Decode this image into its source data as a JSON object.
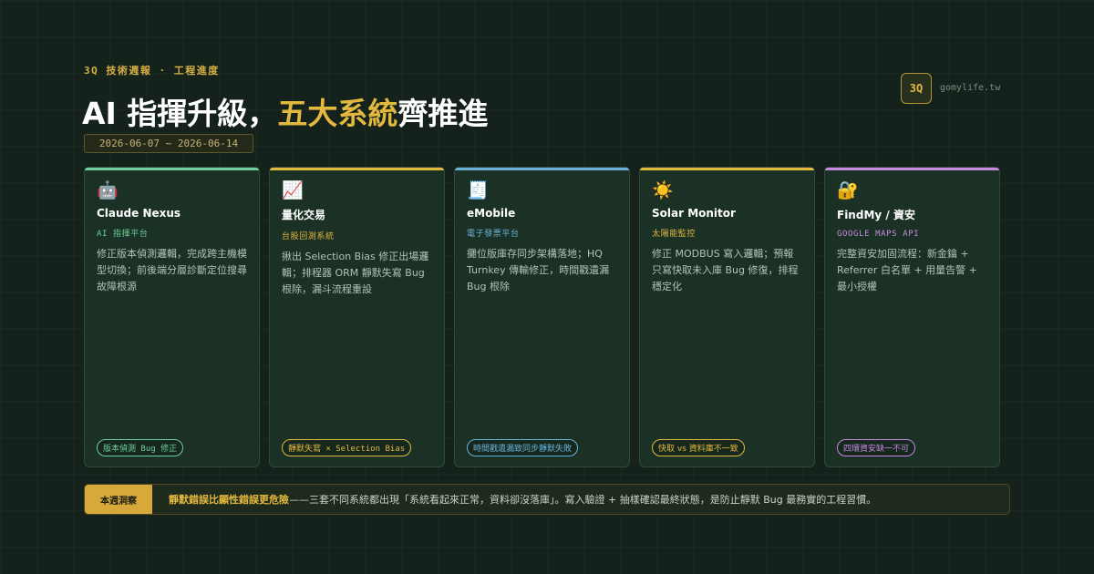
{
  "header": {
    "kicker": "3Q 技術週報 · 工程進度",
    "title_prefix": "AI 指揮升級，",
    "title_highlight": "五大系統",
    "title_suffix": "齊推進",
    "date_range": "2026-06-07 ~ 2026-06-14",
    "brand_badge": "3Q",
    "brand_domain": "gomylife.tw"
  },
  "cards": [
    {
      "icon": "🤖",
      "icon_name": "robot-icon",
      "name": "Claude Nexus",
      "subtitle": "AI 指揮平台",
      "description": "修正版本偵測邏輯，完成跨主機模型切換；前後端分層診斷定位搜尋故障根源",
      "tag": "版本偵測 Bug 修正",
      "accent_color": "#6fcf9c"
    },
    {
      "icon": "📈",
      "icon_name": "chart-up-icon",
      "name": "量化交易",
      "subtitle": "台股回測系統",
      "description": "揪出 Selection Bias 修正出場邏輯；排程器 ORM 靜默失寫 Bug 根除，漏斗流程重設",
      "tag": "靜默失寫 × Selection Bias",
      "accent_color": "#e2b83e"
    },
    {
      "icon": "🧾",
      "icon_name": "receipt-icon",
      "name": "eMobile",
      "subtitle": "電子發票平台",
      "description": "攤位版庫存同步架構落地；HQ Turnkey 傳輸修正，時間戳遺漏 Bug 根除",
      "tag": "時間戳遺漏致同步靜默失敗",
      "accent_color": "#6ab2d8"
    },
    {
      "icon": "☀️",
      "icon_name": "sun-icon",
      "name": "Solar Monitor",
      "subtitle": "太陽能監控",
      "description": "修正 MODBUS 寫入邏輯；預報只寫快取未入庫 Bug 修復，排程穩定化",
      "tag": "快取 vs 資料庫不一致",
      "accent_color": "#e2b83e"
    },
    {
      "icon": "🔐",
      "icon_name": "lock-key-icon",
      "name": "FindMy / 資安",
      "subtitle": "GOOGLE MAPS API",
      "description": "完整資安加固流程：新金鑰 + Referrer 白名單 + 用量告警 + 最小授權",
      "tag": "四環資安缺一不可",
      "accent_color": "#c58ae0"
    }
  ],
  "insight": {
    "label": "本週洞察",
    "highlight": "靜默錯誤比顯性錯誤更危險",
    "text": "——三套不同系統都出現「系統看起來正常，資料卻沒落庫」。寫入驗證 + 抽樣確認最終狀態，是防止靜默 Bug 最務實的工程習慣。"
  }
}
